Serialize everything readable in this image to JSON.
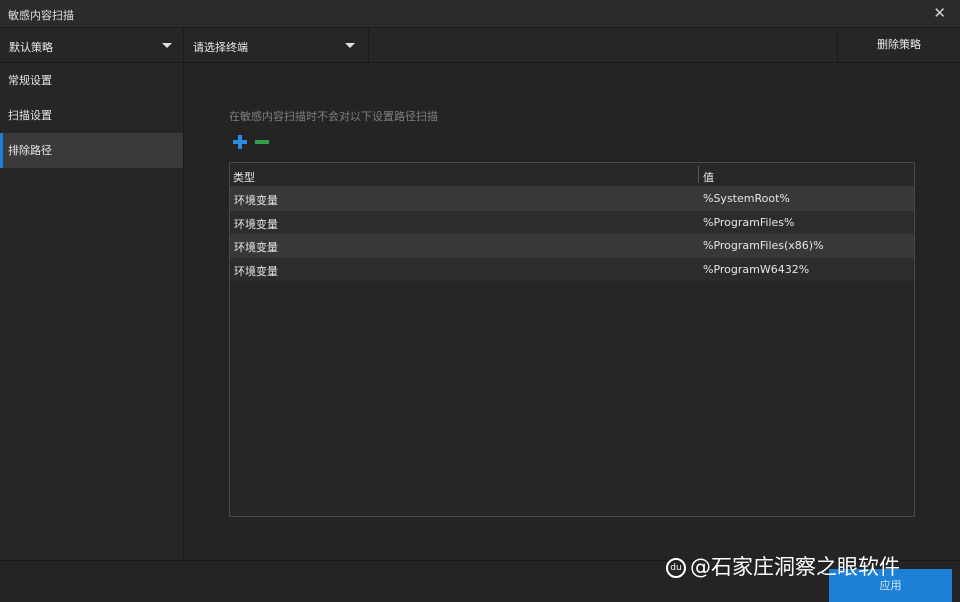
{
  "window": {
    "title": "敏感内容扫描"
  },
  "toolbar": {
    "policy_dropdown": {
      "value": "默认策略"
    },
    "terminal_dropdown": {
      "value": "请选择终端"
    },
    "delete_policy_label": "删除策略"
  },
  "sidebar": {
    "items": [
      {
        "label": "常规设置",
        "active": false
      },
      {
        "label": "扫描设置",
        "active": false
      },
      {
        "label": "排除路径",
        "active": true
      }
    ]
  },
  "main": {
    "hint": "在敏感内容扫描时不会对以下设置路径扫描",
    "icons": {
      "add": "plus-icon",
      "remove": "minus-icon"
    },
    "table": {
      "headers": {
        "type": "类型",
        "value": "值"
      },
      "rows": [
        {
          "type": "环境变量",
          "value": "%SystemRoot%"
        },
        {
          "type": "环境变量",
          "value": "%ProgramFiles%"
        },
        {
          "type": "环境变量",
          "value": "%ProgramFiles(x86)%"
        },
        {
          "type": "环境变量",
          "value": "%ProgramW6432%"
        }
      ]
    }
  },
  "footer": {
    "apply_label": "应用",
    "watermark": "@石家庄洞察之眼软件",
    "watermark_logo": "du"
  },
  "colors": {
    "accent": "#1e7fd6",
    "add": "#2a8be0",
    "remove": "#30a046",
    "background": "#242424"
  }
}
